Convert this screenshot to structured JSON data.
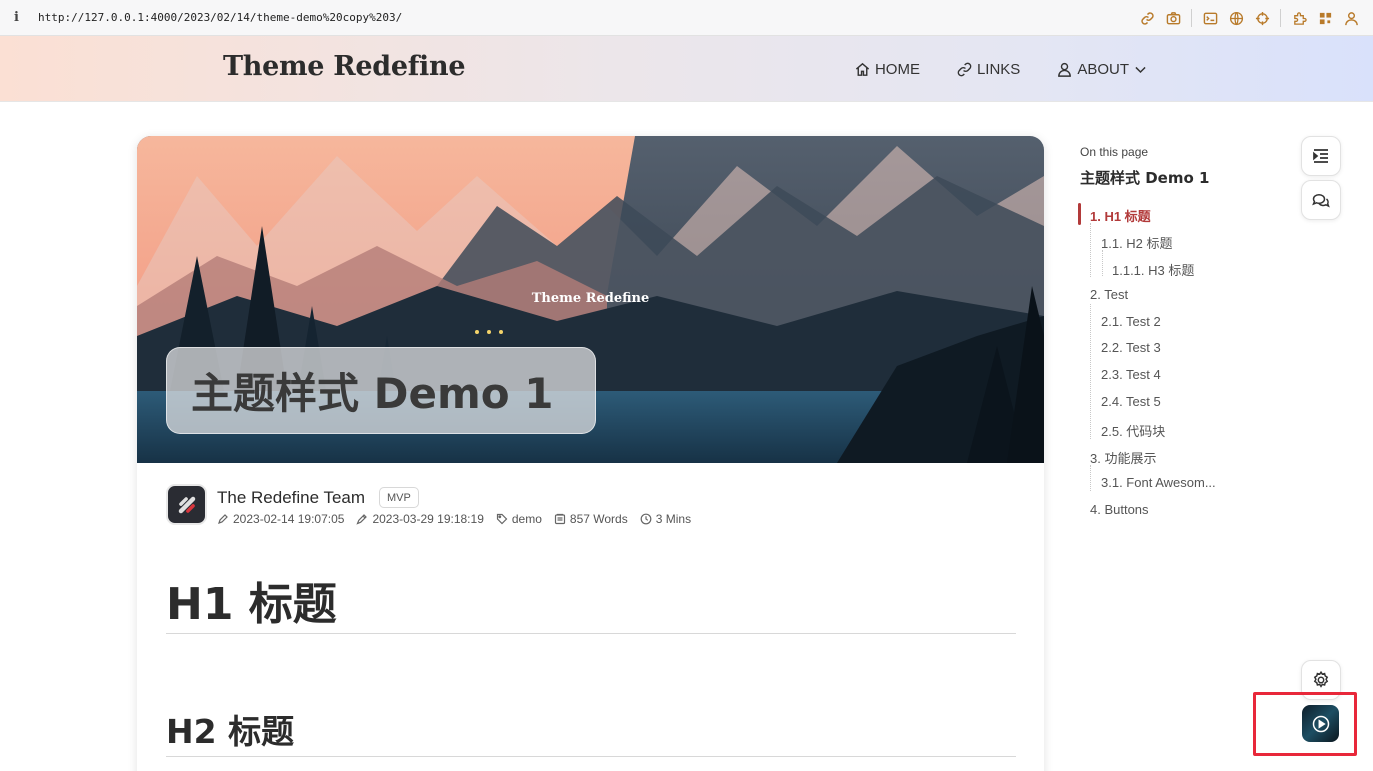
{
  "browser": {
    "info_glyph": "i",
    "url": "http://127.0.0.1:4000/2023/02/14/theme-demo%20copy%203/",
    "toolbar_icons": [
      "link-icon",
      "camera-icon",
      "terminal-icon",
      "globe-icon",
      "crosshair-icon",
      "extension-icon",
      "qr-icon",
      "user-icon"
    ]
  },
  "header": {
    "site_title": "Theme Redefine",
    "nav": [
      {
        "label": "HOME",
        "icon": "home-icon"
      },
      {
        "label": "LINKS",
        "icon": "link-icon"
      },
      {
        "label": "ABOUT",
        "icon": "user-icon"
      }
    ]
  },
  "post": {
    "banner_watermark": "Theme Redefine",
    "title": "主题样式 Demo 1",
    "author": "The Redefine Team",
    "badge": "MVP",
    "created": "2023-02-14 19:07:05",
    "updated": "2023-03-29 19:18:19",
    "tag": "demo",
    "words": "857 Words",
    "read_time": "3 Mins",
    "h1": "H1 标题",
    "h2": "H2 标题"
  },
  "toc": {
    "label": "On this page",
    "title": "主题样式 Demo 1",
    "items": [
      {
        "text": "1. H1 标题",
        "level": 1,
        "active": true
      },
      {
        "text": "1.1. H2 标题",
        "level": 2
      },
      {
        "text": "1.1.1. H3 标题",
        "level": 3
      },
      {
        "text": "2. Test",
        "level": 1
      },
      {
        "text": "2.1. Test 2",
        "level": 2
      },
      {
        "text": "2.2. Test 3",
        "level": 2
      },
      {
        "text": "2.3. Test 4",
        "level": 2
      },
      {
        "text": "2.4. Test 5",
        "level": 2
      },
      {
        "text": "2.5. 代码块",
        "level": 2
      },
      {
        "text": "3. 功能展示",
        "level": 1
      },
      {
        "text": "3.1. Font Awesom...",
        "level": 2
      },
      {
        "text": "4. Buttons",
        "level": 1
      }
    ]
  },
  "colors": {
    "accent": "#b23a3a",
    "highlight": "#e8283a"
  }
}
